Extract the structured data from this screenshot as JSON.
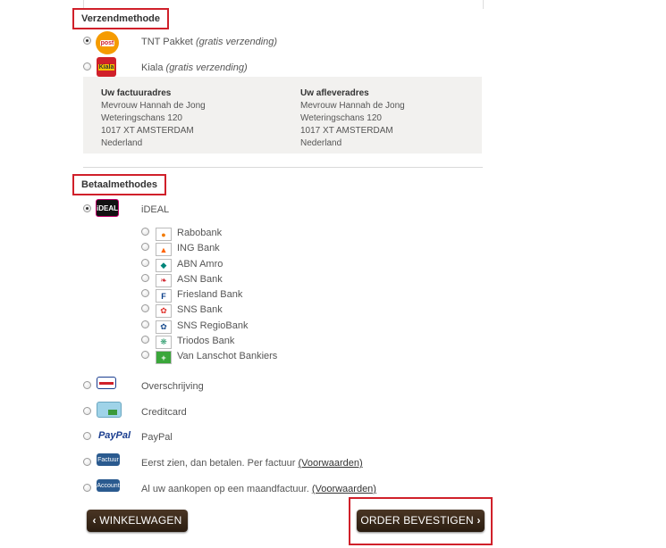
{
  "shipping": {
    "title": "Verzendmethode",
    "options": [
      {
        "label": "TNT Pakket",
        "note": "(gratis verzending)",
        "logo_text": "post",
        "checked": true
      },
      {
        "label": "Kiala",
        "note": "(gratis verzending)",
        "logo_text": "Kiala",
        "checked": false
      }
    ],
    "invoice_address": {
      "heading": "Uw factuuradres",
      "lines": [
        "Mevrouw Hannah de Jong",
        "Weteringschans 120",
        "1017 XT AMSTERDAM",
        "Nederland"
      ]
    },
    "delivery_address": {
      "heading": "Uw afleveradres",
      "lines": [
        "Mevrouw Hannah de Jong",
        "Weteringschans 120",
        "1017 XT AMSTERDAM",
        "Nederland"
      ]
    }
  },
  "payment": {
    "title": "Betaalmethodes",
    "ideal": {
      "label": "iDEAL",
      "logo_text": "iDEAL",
      "checked": true
    },
    "banks": [
      {
        "label": "Rabobank",
        "icon": "rabobank-icon",
        "color": "#f27a00"
      },
      {
        "label": "ING Bank",
        "icon": "ing-icon",
        "color": "#ff6200"
      },
      {
        "label": "ABN Amro",
        "icon": "abn-amro-icon",
        "color": "#00857a"
      },
      {
        "label": "ASN Bank",
        "icon": "asn-icon",
        "color": "#d0202a"
      },
      {
        "label": "Friesland Bank",
        "icon": "friesland-icon",
        "color": "#0b3f8a"
      },
      {
        "label": "SNS Bank",
        "icon": "sns-icon",
        "color": "#e0312c"
      },
      {
        "label": "SNS RegioBank",
        "icon": "regiobank-icon",
        "color": "#1a4d8f"
      },
      {
        "label": "Triodos Bank",
        "icon": "triodos-icon",
        "color": "#2a9a6a"
      },
      {
        "label": "Van Lanschot Bankiers",
        "icon": "van-lanschot-icon",
        "color": "#3aa63a"
      }
    ],
    "others": [
      {
        "label": "Overschrijving",
        "icon": "bank-transfer-icon"
      },
      {
        "label": "Creditcard",
        "icon": "creditcard-icon"
      },
      {
        "label": "PayPal",
        "icon": "paypal-icon",
        "logo_text": "PayPal"
      },
      {
        "label": "Eerst zien, dan betalen. Per factuur",
        "link": "(Voorwaarden)",
        "icon": "factuur-icon",
        "logo_text": "Factuur"
      },
      {
        "label": "Al uw aankopen op een maandfactuur.",
        "link": "(Voorwaarden)",
        "icon": "account-icon",
        "logo_text": "Account"
      }
    ]
  },
  "buttons": {
    "back": "WINKELWAGEN",
    "confirm": "ORDER BEVESTIGEN"
  },
  "colors": {
    "highlight": "#d0202a",
    "button": "#3a2818"
  }
}
